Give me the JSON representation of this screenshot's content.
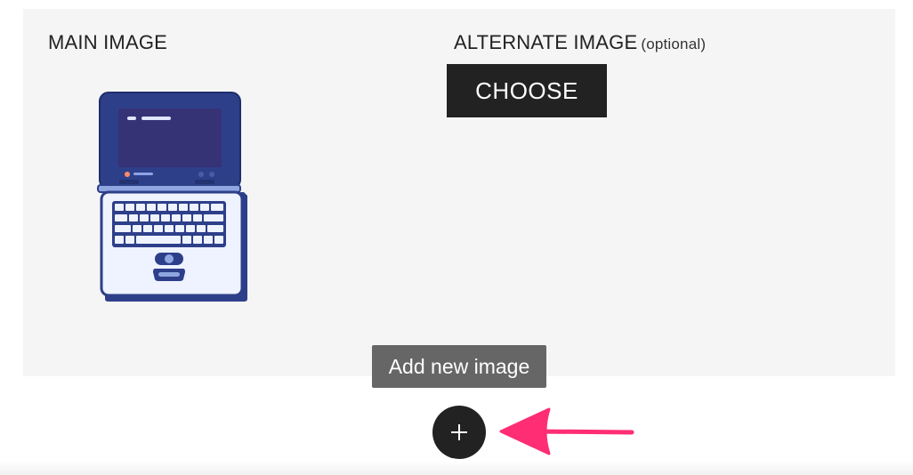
{
  "main_image": {
    "label": "MAIN IMAGE",
    "thumbnail_icon": "laptop-illustration"
  },
  "alternate_image": {
    "label": "ALTERNATE IMAGE",
    "optional_note": "(optional)",
    "choose_label": "CHOOSE"
  },
  "add_image": {
    "tooltip": "Add new image",
    "icon": "plus-icon"
  },
  "annotation": {
    "icon": "arrow-left-icon",
    "color": "#ff2d74"
  },
  "colors": {
    "panel_bg": "#f5f5f5",
    "button_bg": "#222222",
    "tooltip_bg": "#666666",
    "laptop_body": "#2e3f8a",
    "laptop_screen": "#363276",
    "laptop_deck": "#eef3ff"
  }
}
